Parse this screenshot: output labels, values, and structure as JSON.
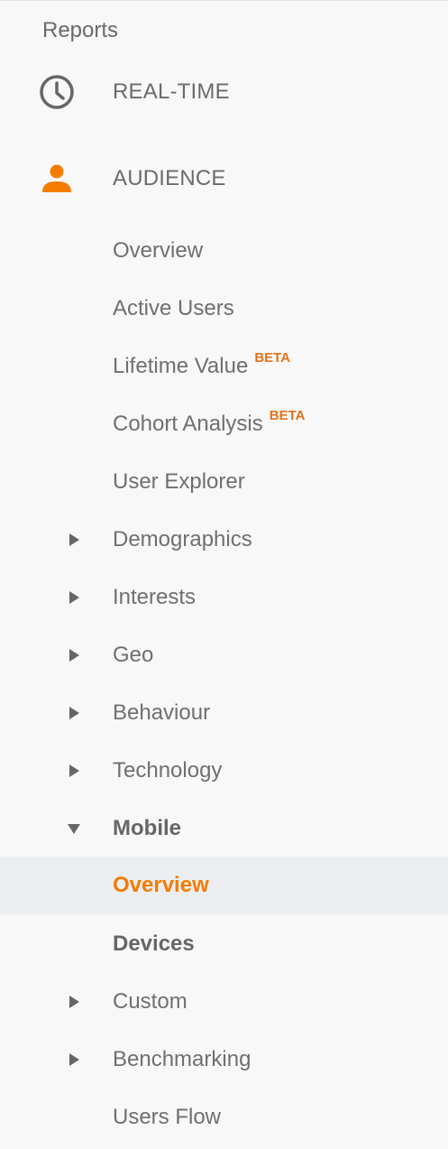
{
  "header": {
    "title": "Reports"
  },
  "colors": {
    "accent": "#f57c00",
    "text": "#6f6f6f",
    "icon_gray": "#666666",
    "selected_bg": "#eceef1"
  },
  "sections": [
    {
      "label": "REAL-TIME",
      "icon": "clock-icon"
    },
    {
      "label": "AUDIENCE",
      "icon": "person-icon"
    }
  ],
  "audience_items": [
    {
      "label": "Overview"
    },
    {
      "label": "Active Users"
    },
    {
      "label": "Lifetime Value",
      "badge": "BETA"
    },
    {
      "label": "Cohort Analysis",
      "badge": "BETA"
    },
    {
      "label": "User Explorer"
    },
    {
      "label": "Demographics",
      "expander": "collapsed"
    },
    {
      "label": "Interests",
      "expander": "collapsed"
    },
    {
      "label": "Geo",
      "expander": "collapsed"
    },
    {
      "label": "Behaviour",
      "expander": "collapsed"
    },
    {
      "label": "Technology",
      "expander": "collapsed"
    },
    {
      "label": "Mobile",
      "expander": "expanded"
    },
    {
      "label": "Overview",
      "state": "selected"
    },
    {
      "label": "Devices"
    },
    {
      "label": "Custom",
      "expander": "collapsed"
    },
    {
      "label": "Benchmarking",
      "expander": "collapsed"
    },
    {
      "label": "Users Flow"
    }
  ]
}
